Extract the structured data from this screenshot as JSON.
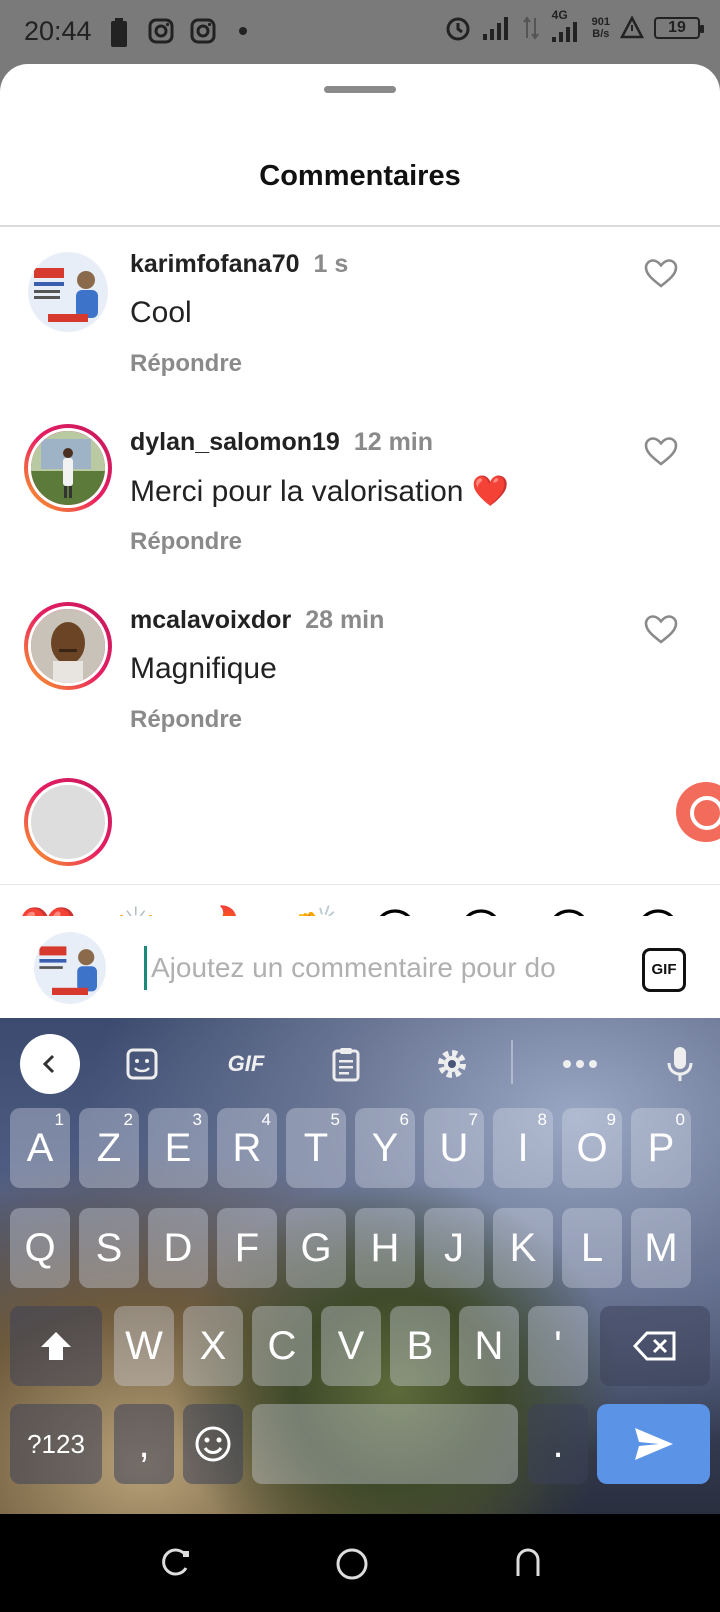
{
  "status_bar": {
    "time": "20:44",
    "network_speed_value": "901",
    "network_speed_unit": "B/s",
    "network_type": "4G",
    "battery": "19"
  },
  "sheet": {
    "title": "Commentaires"
  },
  "comments": [
    {
      "username": "karimfofana70",
      "time": "1 s",
      "text": "Cool",
      "reply": "Répondre"
    },
    {
      "username": "dylan_salomon19",
      "time": "12 min",
      "text": "Merci pour la valorisation ❤️",
      "reply": "Répondre"
    },
    {
      "username": "mcalavoixdor",
      "time": "28 min",
      "text": "Magnifique",
      "reply": "Répondre"
    }
  ],
  "emoji_bar": [
    "❤️",
    "🙌",
    "🔥",
    "👏",
    "😢",
    "😍",
    "😮",
    "😂"
  ],
  "composer": {
    "placeholder": "Ajoutez un commentaire pour do",
    "gif_label": "GIF"
  },
  "keyboard": {
    "toolbar_gif": "GIF",
    "row1": [
      {
        "k": "A",
        "h": "1"
      },
      {
        "k": "Z",
        "h": "2"
      },
      {
        "k": "E",
        "h": "3"
      },
      {
        "k": "R",
        "h": "4"
      },
      {
        "k": "T",
        "h": "5"
      },
      {
        "k": "Y",
        "h": "6"
      },
      {
        "k": "U",
        "h": "7"
      },
      {
        "k": "I",
        "h": "8"
      },
      {
        "k": "O",
        "h": "9"
      },
      {
        "k": "P",
        "h": "0"
      }
    ],
    "row2": [
      "Q",
      "S",
      "D",
      "F",
      "G",
      "H",
      "J",
      "K",
      "L",
      "M"
    ],
    "row3": [
      "W",
      "X",
      "C",
      "V",
      "B",
      "N",
      "'"
    ],
    "symbols_label": "?123",
    "comma": ",",
    "period": "."
  }
}
